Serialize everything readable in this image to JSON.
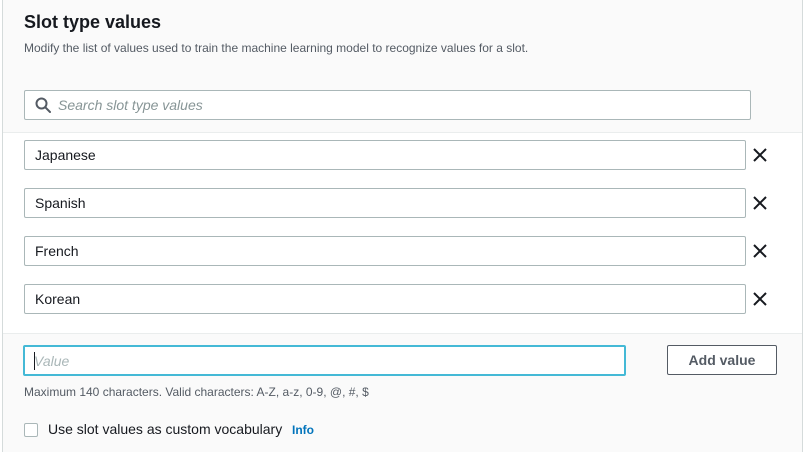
{
  "section": {
    "title": "Slot type values",
    "description": "Modify the list of values used to train the machine learning model to recognize values for a slot."
  },
  "search": {
    "placeholder": "Search slot type values",
    "value": ""
  },
  "slot_values": [
    {
      "value": "Japanese"
    },
    {
      "value": "Spanish"
    },
    {
      "value": "French"
    },
    {
      "value": "Korean"
    }
  ],
  "new_value": {
    "placeholder": "Value",
    "value": ""
  },
  "add_button": {
    "label": "Add value"
  },
  "hint": "Maximum 140 characters. Valid characters: A-Z, a-z, 0-9, @, #, $",
  "custom_vocabulary": {
    "label": "Use slot values as custom vocabulary",
    "checked": false,
    "info_link": "Info"
  },
  "icons": {
    "search": "search-icon",
    "remove": "close-icon"
  },
  "colors": {
    "focus_border": "#44b9d6",
    "link": "#0073bb",
    "text": "#16191f",
    "secondary_text": "#545b64"
  }
}
